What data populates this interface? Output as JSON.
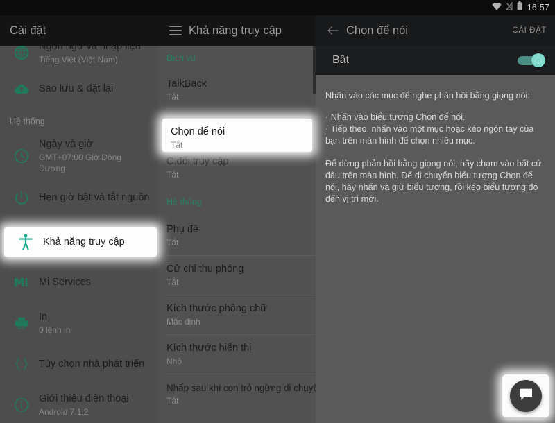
{
  "colors": {
    "accent_green": "#1f7a5a",
    "section_green": "#2a7f62",
    "toggle_on": "#7fd9cb",
    "statusbar_bg": "#0c0c0c",
    "appbar_bg": "#141414",
    "sidebar_bg": "#4d4d4d",
    "midcol_bg": "#515151",
    "rightpanel_bg": "#5a5a5a"
  },
  "statusbar": {
    "time": "16:57",
    "icons": [
      "wifi-icon",
      "signal-off-icon",
      "battery-icon"
    ]
  },
  "appbar": {
    "left_title": "Cài đặt",
    "middle_title": "Khả năng truy cập",
    "right_title": "Chọn để nói",
    "right_action": "CÀI ĐẶT",
    "menu_icon": "hamburger-menu-icon",
    "back_icon": "back-arrow-icon"
  },
  "sidebar": {
    "items": [
      {
        "icon": "globe-icon",
        "title": "Ngôn ngữ và nhập liệu",
        "sub": "Tiếng Việt (Việt Nam)"
      },
      {
        "icon": "cloud-upload-icon",
        "title": "Sao lưu & đặt lại",
        "sub": ""
      }
    ],
    "section_label": "Hệ thống",
    "system_items": [
      {
        "icon": "clock-icon",
        "title": "Ngày và giờ",
        "sub": "GMT+07:00 Giờ Đông Dương"
      },
      {
        "icon": "power-icon",
        "title": "Hẹn giờ bật và tắt nguồn",
        "sub": ""
      },
      {
        "icon": "accessibility-icon",
        "title": "Khả năng truy cập",
        "sub": ""
      },
      {
        "icon": "mi-icon",
        "title": "Mi Services",
        "sub": ""
      },
      {
        "icon": "printer-icon",
        "title": "In",
        "sub": "0 lệnh in"
      },
      {
        "icon": "braces-icon",
        "title": "Tùy chọn nhà phát triển",
        "sub": ""
      },
      {
        "icon": "info-icon",
        "title": "Giới thiệu điện thoại",
        "sub": "Android 7.1.2"
      }
    ],
    "highlighted": "Khả năng truy cập"
  },
  "middle": {
    "section_services": "Dịch vụ",
    "services": [
      {
        "title": "TalkBack",
        "sub": "Tắt"
      },
      {
        "title": "Chọn để nói",
        "sub": "Tắt"
      },
      {
        "title": "C.đổi truy cập",
        "sub": "Tắt"
      }
    ],
    "section_system": "Hệ thống",
    "system": [
      {
        "title": "Phụ đề",
        "sub": "Tắt"
      },
      {
        "title": "Cử chỉ thu phóng",
        "sub": "Tắt"
      },
      {
        "title": "Kích thước phông chữ",
        "sub": "Mặc định"
      },
      {
        "title": "Kích thước hiển thị",
        "sub": "Nhỏ"
      },
      {
        "title": "Nhấp sau khi con trỏ ngừng di chuyển",
        "sub": "Tắt"
      }
    ],
    "highlighted": "Chọn để nói"
  },
  "right": {
    "toggle_label": "Bật",
    "toggle_state": "on",
    "intro": "Nhấn vào các mục để nghe phản hồi bằng giọng nói:",
    "bullets": [
      "· Nhấn vào biểu tượng Chọn để nói.",
      "· Tiếp theo, nhấn vào một mục hoặc kéo ngón tay của bạn trên màn hình để chọn nhiều mục."
    ],
    "paragraph": "Để dừng phản hồi bằng giọng nói, hãy chạm vào bất cứ đâu trên màn hình. Để di chuyển biểu tượng Chọn để nói, hãy nhấn và giữ biểu tượng, rồi kéo biểu tượng đó đến vị trí mới."
  },
  "fab": {
    "icon": "chat-bubble-icon"
  }
}
